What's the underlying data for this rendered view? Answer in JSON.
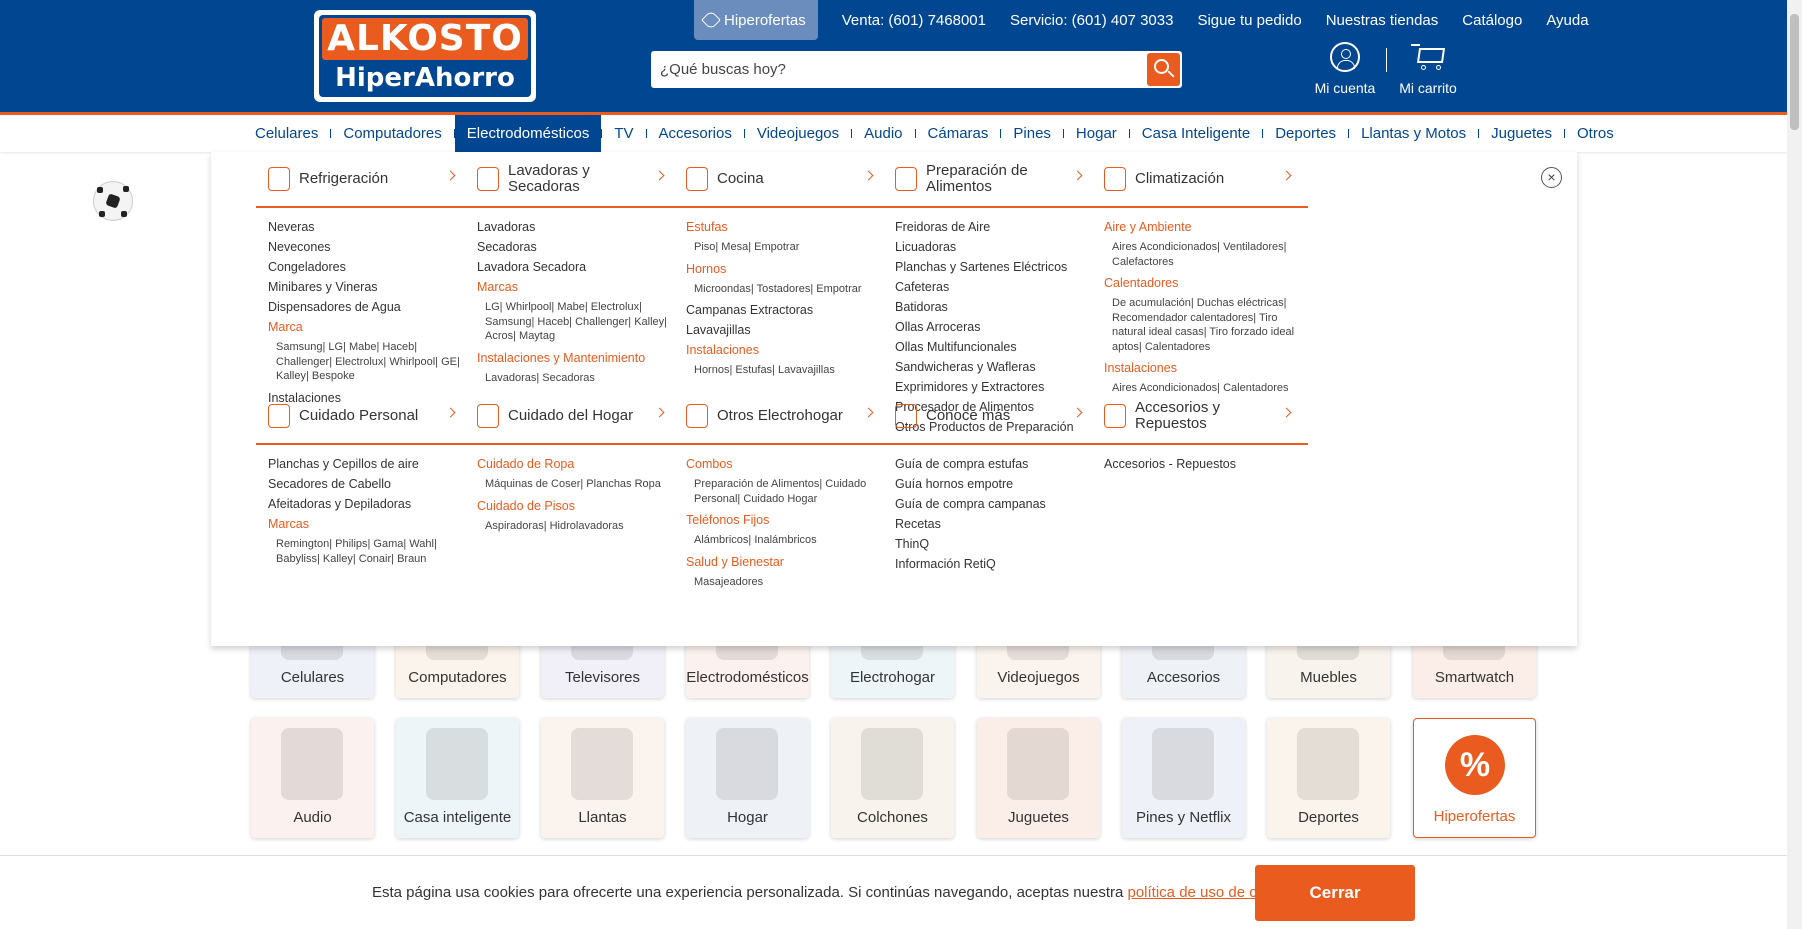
{
  "brand": {
    "logo_top": "ALKOSTO",
    "logo_bottom": "HiperAhorro",
    "accent": "#e95b1e",
    "primary": "#004691"
  },
  "topnav": {
    "hiperofertas": "Hiperofertas",
    "venta": "Venta: (601) 7468001",
    "servicio": "Servicio: (601) 407 3033",
    "pedido": "Sigue tu pedido",
    "tiendas": "Nuestras tiendas",
    "catalogo": "Catálogo",
    "ayuda": "Ayuda"
  },
  "search": {
    "placeholder": "¿Qué buscas hoy?"
  },
  "account": {
    "label": "Mi cuenta",
    "icon": "user-icon"
  },
  "cart": {
    "label": "Mi carrito",
    "icon": "cart-icon"
  },
  "categories": [
    "Celulares",
    "Computadores",
    "Electrodomésticos",
    "TV",
    "Accesorios",
    "Videojuegos",
    "Audio",
    "Cámaras",
    "Pines",
    "Hogar",
    "Casa Inteligente",
    "Deportes",
    "Llantas y Motos",
    "Juguetes",
    "Otros"
  ],
  "active_category": "Electrodomésticos",
  "mega": {
    "columns": [
      {
        "title": "Refrigeración",
        "links": [
          {
            "t": "Neveras"
          },
          {
            "t": "Nevecones"
          },
          {
            "t": "Congeladores"
          },
          {
            "t": "Minibares y Vineras"
          },
          {
            "t": "Dispensadores de Agua"
          },
          {
            "t": "Marca",
            "k": "or"
          },
          {
            "t": "Samsung| LG| Mabe| Haceb| Challenger| Electrolux| Whirlpool| GE| Kalley| Bespoke",
            "k": "sub"
          },
          {
            "t": "Instalaciones"
          }
        ]
      },
      {
        "title": "Lavadoras y Secadoras",
        "links": [
          {
            "t": "Lavadoras"
          },
          {
            "t": "Secadoras"
          },
          {
            "t": "Lavadora Secadora"
          },
          {
            "t": "Marcas",
            "k": "or"
          },
          {
            "t": "LG| Whirlpool| Mabe| Electrolux| Samsung| Haceb| Challenger| Kalley| Acros| Maytag",
            "k": "sub"
          },
          {
            "t": "Instalaciones y Mantenimiento",
            "k": "or"
          },
          {
            "t": "Lavadoras| Secadoras",
            "k": "sub"
          }
        ]
      },
      {
        "title": "Cocina",
        "links": [
          {
            "t": "Estufas",
            "k": "or"
          },
          {
            "t": "Piso| Mesa| Empotrar",
            "k": "sub"
          },
          {
            "t": "Hornos",
            "k": "or"
          },
          {
            "t": "Microondas| Tostadores| Empotrar",
            "k": "sub"
          },
          {
            "t": "Campanas Extractoras"
          },
          {
            "t": "Lavavajillas"
          },
          {
            "t": "Instalaciones",
            "k": "or"
          },
          {
            "t": "Hornos| Estufas| Lavavajillas",
            "k": "sub"
          }
        ]
      },
      {
        "title": "Preparación de Alimentos",
        "links": [
          {
            "t": "Freidoras de Aire"
          },
          {
            "t": "Licuadoras"
          },
          {
            "t": "Planchas y Sartenes Eléctricos"
          },
          {
            "t": "Cafeteras"
          },
          {
            "t": "Batidoras"
          },
          {
            "t": "Ollas Arroceras"
          },
          {
            "t": "Ollas Multifuncionales"
          },
          {
            "t": "Sandwicheras y Wafleras"
          },
          {
            "t": "Exprimidores y Extractores"
          },
          {
            "t": "Procesador de Alimentos"
          },
          {
            "t": "Otros Productos de Preparación"
          }
        ]
      },
      {
        "title": "Climatización",
        "links": [
          {
            "t": "Aire y Ambiente",
            "k": "or"
          },
          {
            "t": "Aires Acondicionados| Ventiladores| Calefactores",
            "k": "sub"
          },
          {
            "t": "Calentadores",
            "k": "or"
          },
          {
            "t": "De acumulación| Duchas eléctricas| Recomendador calentadores| Tiro natural ideal casas| Tiro forzado ideal aptos| Calentadores",
            "k": "sub"
          },
          {
            "t": "Instalaciones",
            "k": "or"
          },
          {
            "t": "Aires Acondicionados| Calentadores",
            "k": "sub"
          }
        ]
      },
      {
        "title": "Cuidado Personal",
        "links": [
          {
            "t": "Planchas y Cepillos de aire"
          },
          {
            "t": "Secadores de Cabello"
          },
          {
            "t": "Afeitadoras y Depiladoras"
          },
          {
            "t": "Marcas",
            "k": "or"
          },
          {
            "t": "Remington| Philips| Gama| Wahl| Babyliss| Kalley| Conair| Braun",
            "k": "sub"
          }
        ]
      },
      {
        "title": "Cuidado del Hogar",
        "links": [
          {
            "t": "Cuidado de Ropa",
            "k": "or"
          },
          {
            "t": "Máquinas de Coser| Planchas Ropa",
            "k": "sub"
          },
          {
            "t": "Cuidado de Pisos",
            "k": "or"
          },
          {
            "t": "Aspiradoras| Hidrolavadoras",
            "k": "sub"
          }
        ]
      },
      {
        "title": "Otros Electrohogar",
        "links": [
          {
            "t": "Combos",
            "k": "or"
          },
          {
            "t": "Preparación de Alimentos| Cuidado Personal| Cuidado Hogar",
            "k": "sub"
          },
          {
            "t": "Teléfonos Fijos",
            "k": "or"
          },
          {
            "t": "Alámbricos| Inalámbricos",
            "k": "sub"
          },
          {
            "t": "Salud y Bienestar",
            "k": "or"
          },
          {
            "t": "Masajeadores",
            "k": "sub"
          }
        ]
      },
      {
        "title": "Conoce más",
        "links": [
          {
            "t": "Guía de compra estufas"
          },
          {
            "t": "Guía hornos empotre"
          },
          {
            "t": "Guía de compra campanas"
          },
          {
            "t": "Recetas"
          },
          {
            "t": "ThinQ"
          },
          {
            "t": "Información RetiQ"
          }
        ]
      },
      {
        "title": "Accesorios y Repuestos",
        "links": [
          {
            "t": "Accesorios - Repuestos"
          }
        ]
      }
    ]
  },
  "tiles": {
    "row1": [
      "Celulares",
      "Computadores",
      "Televisores",
      "Electrodomésticos",
      "Electrohogar",
      "Videojuegos",
      "Accesorios",
      "Muebles",
      "Smartwatch"
    ],
    "row2": [
      "Audio",
      "Casa inteligente",
      "Llantas",
      "Hogar",
      "Colchones",
      "Juguetes",
      "Pines y Netflix",
      "Deportes",
      "Hiperofertas"
    ]
  },
  "cookie": {
    "text": "Esta página usa cookies para ofrecerte una experiencia personalizada. Si continúas navegando, aceptas nuestra ",
    "link": "política de uso de cookies",
    "end": ".",
    "button": "Cerrar"
  }
}
